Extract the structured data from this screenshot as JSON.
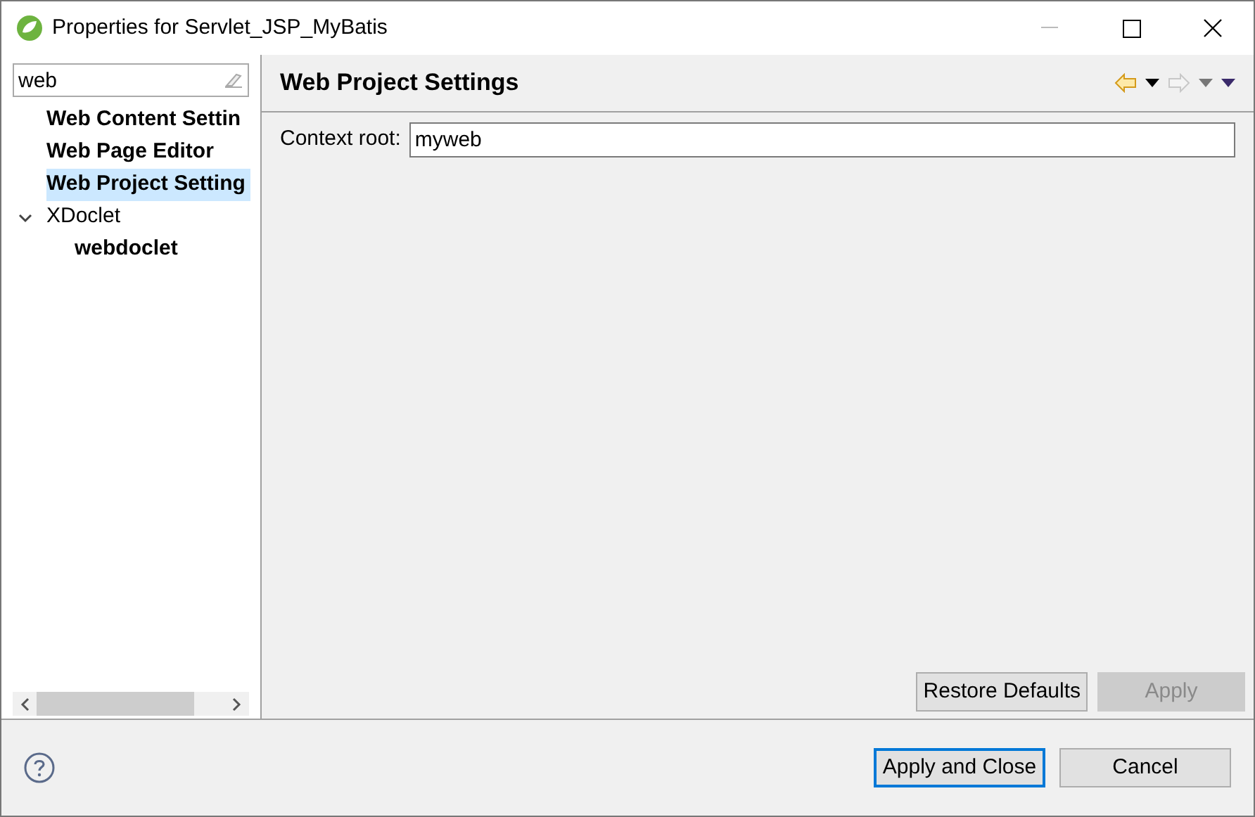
{
  "window": {
    "title": "Properties for Servlet_JSP_MyBatis"
  },
  "filter": {
    "value": "web"
  },
  "tree": [
    {
      "label": "Web Content Settin",
      "bold": true,
      "selected": false
    },
    {
      "label": "Web Page Editor",
      "bold": true,
      "selected": false
    },
    {
      "label": "Web Project Setting",
      "bold": true,
      "selected": true
    },
    {
      "label": "XDoclet",
      "bold": false,
      "selected": false,
      "expanded": true,
      "children": [
        {
          "label": "webdoclet",
          "bold": true,
          "selected": false
        }
      ]
    }
  ],
  "page": {
    "title": "Web Project Settings",
    "back_disabled": false,
    "forward_disabled": true
  },
  "fields": [
    {
      "label": "Context root:",
      "value": "myweb"
    }
  ],
  "page_buttons": [
    {
      "label": "Restore Defaults",
      "disabled": false
    },
    {
      "label": "Apply",
      "disabled": true
    }
  ],
  "dialog_buttons": [
    {
      "label": "Apply and Close",
      "default": true
    },
    {
      "label": "Cancel",
      "default": false
    }
  ]
}
